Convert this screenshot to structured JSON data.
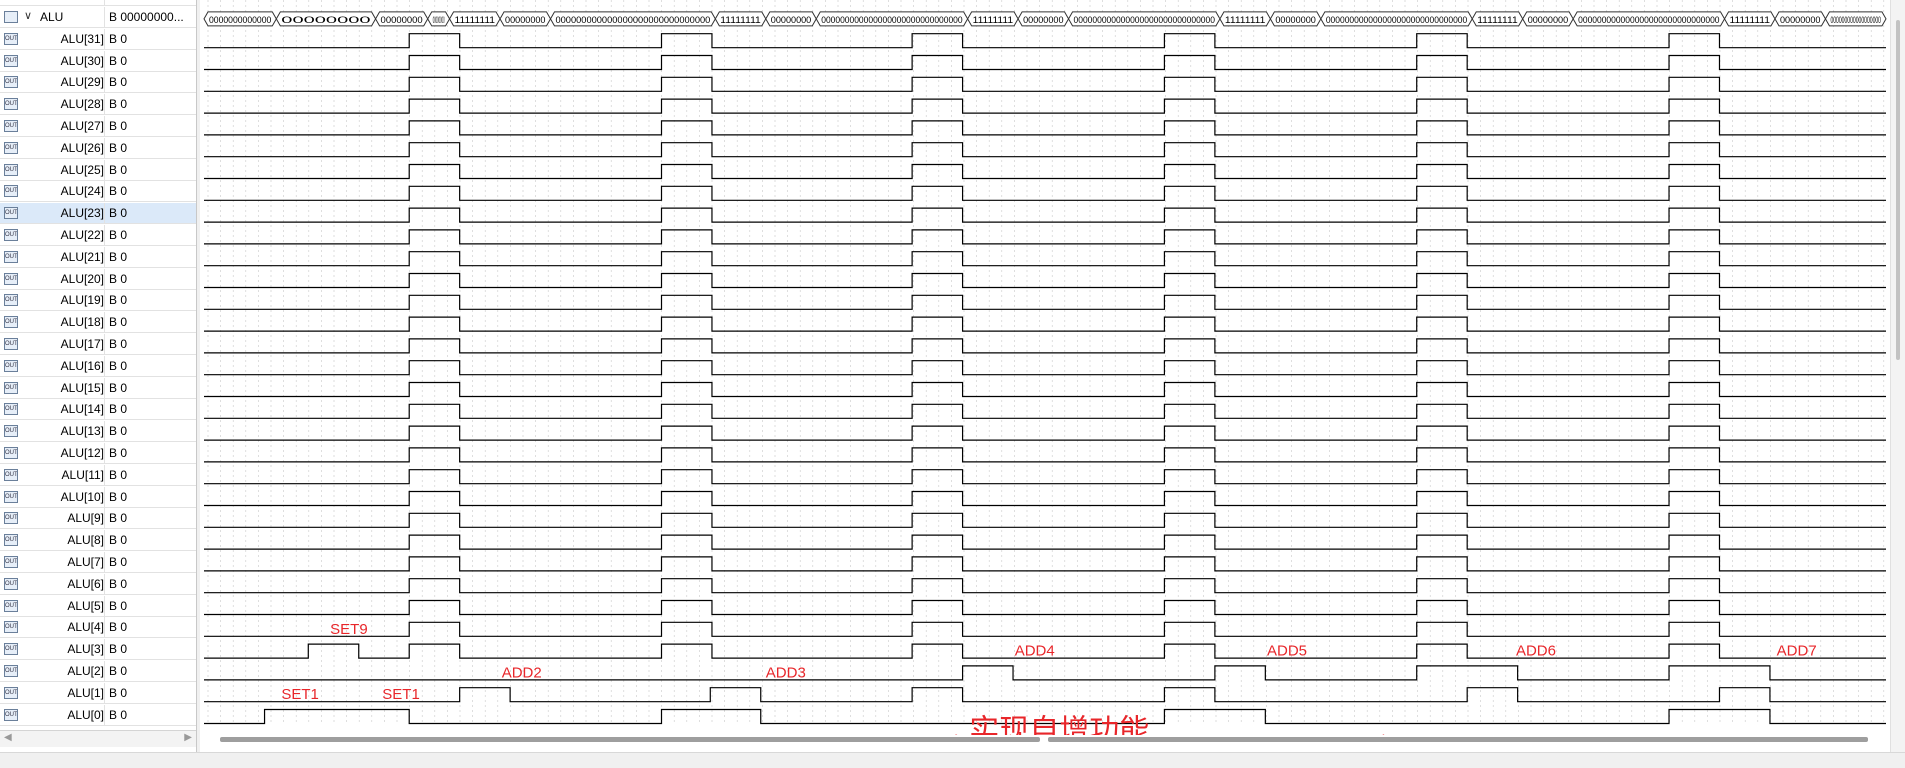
{
  "signals": [
    {
      "name": "ALU",
      "value": "B 00000000...",
      "type": "bus",
      "expanded": true
    },
    {
      "name": "ALU[31]",
      "value": "B 0",
      "icon": "OUT"
    },
    {
      "name": "ALU[30]",
      "value": "B 0",
      "icon": "OUT"
    },
    {
      "name": "ALU[29]",
      "value": "B 0",
      "icon": "OUT"
    },
    {
      "name": "ALU[28]",
      "value": "B 0",
      "icon": "OUT"
    },
    {
      "name": "ALU[27]",
      "value": "B 0",
      "icon": "OUT"
    },
    {
      "name": "ALU[26]",
      "value": "B 0",
      "icon": "OUT"
    },
    {
      "name": "ALU[25]",
      "value": "B 0",
      "icon": "OUT"
    },
    {
      "name": "ALU[24]",
      "value": "B 0",
      "icon": "OUT"
    },
    {
      "name": "ALU[23]",
      "value": "B 0",
      "icon": "OUT",
      "selected": true
    },
    {
      "name": "ALU[22]",
      "value": "B 0",
      "icon": "OUT"
    },
    {
      "name": "ALU[21]",
      "value": "B 0",
      "icon": "OUT"
    },
    {
      "name": "ALU[20]",
      "value": "B 0",
      "icon": "OUT"
    },
    {
      "name": "ALU[19]",
      "value": "B 0",
      "icon": "OUT"
    },
    {
      "name": "ALU[18]",
      "value": "B 0",
      "icon": "OUT"
    },
    {
      "name": "ALU[17]",
      "value": "B 0",
      "icon": "OUT"
    },
    {
      "name": "ALU[16]",
      "value": "B 0",
      "icon": "OUT"
    },
    {
      "name": "ALU[15]",
      "value": "B 0",
      "icon": "OUT"
    },
    {
      "name": "ALU[14]",
      "value": "B 0",
      "icon": "OUT"
    },
    {
      "name": "ALU[13]",
      "value": "B 0",
      "icon": "OUT"
    },
    {
      "name": "ALU[12]",
      "value": "B 0",
      "icon": "OUT"
    },
    {
      "name": "ALU[11]",
      "value": "B 0",
      "icon": "OUT"
    },
    {
      "name": "ALU[10]",
      "value": "B 0",
      "icon": "OUT"
    },
    {
      "name": "ALU[9]",
      "value": "B 0",
      "icon": "OUT"
    },
    {
      "name": "ALU[8]",
      "value": "B 0",
      "icon": "OUT"
    },
    {
      "name": "ALU[7]",
      "value": "B 0",
      "icon": "OUT"
    },
    {
      "name": "ALU[6]",
      "value": "B 0",
      "icon": "OUT"
    },
    {
      "name": "ALU[5]",
      "value": "B 0",
      "icon": "OUT"
    },
    {
      "name": "ALU[4]",
      "value": "B 0",
      "icon": "OUT"
    },
    {
      "name": "ALU[3]",
      "value": "B 0",
      "icon": "OUT"
    },
    {
      "name": "ALU[2]",
      "value": "B 0",
      "icon": "OUT"
    },
    {
      "name": "ALU[1]",
      "value": "B 0",
      "icon": "OUT"
    },
    {
      "name": "ALU[0]",
      "value": "B 0",
      "icon": "OUT"
    }
  ],
  "partial_top_row": {
    "value": "B 0"
  },
  "bus_segments": [
    "0000000000000",
    "00000000",
    "00000000",
    "00000000",
    "11111111",
    "00000000",
    "000000000000000000000000000000",
    "11111111",
    "00000000",
    "000000000000000000000000000000",
    "11111111",
    "00000000",
    "000000000000000000000000000000",
    "11111111",
    "00000000",
    "000000000000000000000000000000",
    "11111111",
    "00000000",
    "000000000000000000000000000000",
    "11111111",
    "00000000",
    "000000000000000000"
  ],
  "annotations": [
    {
      "text": "SET9"
    },
    {
      "text": "SET1"
    },
    {
      "text": "SET1"
    },
    {
      "text": "ADD2"
    },
    {
      "text": "ADD3"
    },
    {
      "text": "ADD4"
    },
    {
      "text": "ADD5"
    },
    {
      "text": "ADD6"
    },
    {
      "text": "ADD7"
    },
    {
      "text": "实现自增功能"
    }
  ],
  "colors": {
    "annotation": "#e8262a",
    "wave": "#000000",
    "grid": "#c8c8c8",
    "selected_row": "#dbe9f9"
  }
}
